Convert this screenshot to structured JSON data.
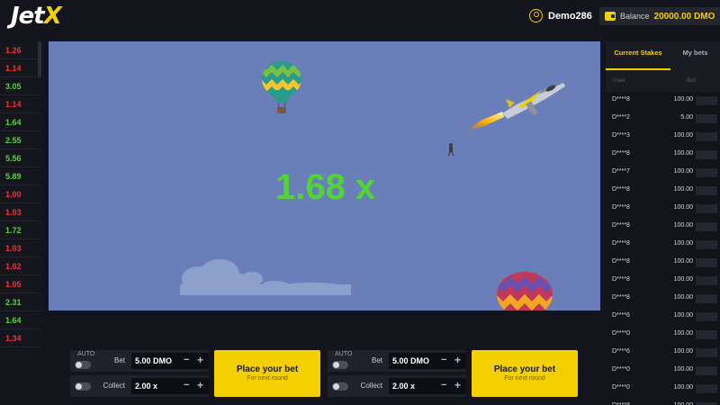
{
  "header": {
    "logo_part1": "Jet",
    "logo_part2": "X",
    "username": "Demo286",
    "balance_label": "Balance",
    "balance_value": "20000.00 DMO"
  },
  "history": [
    {
      "value": "1.26",
      "color": "#e8343b"
    },
    {
      "value": "1.14",
      "color": "#e8343b"
    },
    {
      "value": "3.05",
      "color": "#51d535"
    },
    {
      "value": "1.14",
      "color": "#e8343b"
    },
    {
      "value": "1.64",
      "color": "#51d535"
    },
    {
      "value": "2.55",
      "color": "#51d535"
    },
    {
      "value": "5.56",
      "color": "#51d535"
    },
    {
      "value": "5.89",
      "color": "#51d535"
    },
    {
      "value": "1.00",
      "color": "#e8343b"
    },
    {
      "value": "1.03",
      "color": "#e8343b"
    },
    {
      "value": "1.72",
      "color": "#51d535"
    },
    {
      "value": "1.03",
      "color": "#e8343b"
    },
    {
      "value": "1.02",
      "color": "#e8343b"
    },
    {
      "value": "1.05",
      "color": "#e8343b"
    },
    {
      "value": "2.31",
      "color": "#51d535"
    },
    {
      "value": "1.64",
      "color": "#51d535"
    },
    {
      "value": "1.34",
      "color": "#e8343b"
    }
  ],
  "game": {
    "multiplier": "1.68 x"
  },
  "bet_panels": [
    {
      "auto": "AUTO",
      "bet_label": "Bet",
      "bet_value": "5.00 DMO",
      "collect_label": "Collect",
      "collect_value": "2.00 x",
      "button_title": "Place your bet",
      "button_sub": "For next round"
    },
    {
      "auto": "AUTO",
      "bet_label": "Bet",
      "bet_value": "5.00 DMO",
      "collect_label": "Collect",
      "collect_value": "2.00 x",
      "button_title": "Place your bet",
      "button_sub": "For next round"
    }
  ],
  "right_panel": {
    "tab_current": "Current Stakes",
    "tab_my": "My bets",
    "col_user": "User",
    "col_bet": "Bet",
    "stakes": [
      {
        "user": "D****8",
        "amount": "100.00"
      },
      {
        "user": "D****2",
        "amount": "5.00"
      },
      {
        "user": "D****3",
        "amount": "100.00"
      },
      {
        "user": "D****8",
        "amount": "100.00"
      },
      {
        "user": "D****7",
        "amount": "100.00"
      },
      {
        "user": "D****8",
        "amount": "100.00"
      },
      {
        "user": "D****8",
        "amount": "100.00"
      },
      {
        "user": "D****8",
        "amount": "100.00"
      },
      {
        "user": "D****8",
        "amount": "100.00"
      },
      {
        "user": "D****8",
        "amount": "100.00"
      },
      {
        "user": "D****8",
        "amount": "100.00"
      },
      {
        "user": "D****8",
        "amount": "100.00"
      },
      {
        "user": "D****6",
        "amount": "100.00"
      },
      {
        "user": "D****0",
        "amount": "100.00"
      },
      {
        "user": "D****6",
        "amount": "100.00"
      },
      {
        "user": "D****0",
        "amount": "100.00"
      },
      {
        "user": "D****0",
        "amount": "100.00"
      },
      {
        "user": "D****8",
        "amount": "100.00"
      }
    ]
  }
}
